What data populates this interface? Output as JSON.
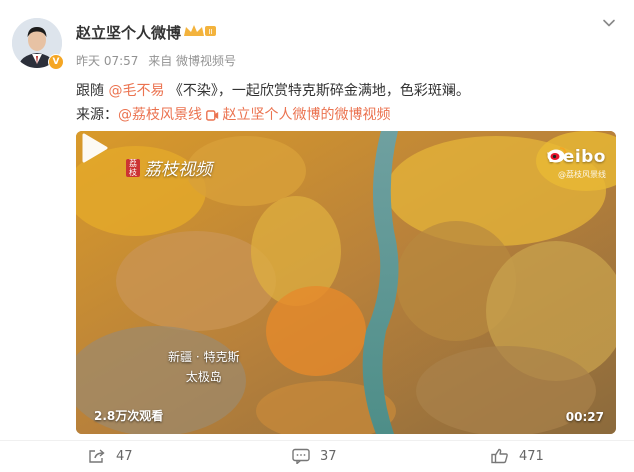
{
  "post": {
    "author": "赵立坚个人微博",
    "time": "昨天 07:57",
    "source": "来自 微博视频号",
    "text_prefix": "跟随 ",
    "mention": "@毛不易",
    "text_rest": " 《不染》，一起欣赏特克斯碎金满地，色彩斑斓。",
    "source_label": "来源：",
    "source_link": "@荔枝风景线",
    "source_video": "赵立坚个人微博的微博视频"
  },
  "video": {
    "badge_box": "荔枝",
    "badge_text": "荔枝视频",
    "watermark": "weibo",
    "watermark_sub": "@荔枝风景线",
    "place_line1": "新疆 · 特克斯",
    "place_line2": "太极岛",
    "views": "2.8万次观看",
    "duration": "00:27"
  },
  "actions": {
    "forward_count": "47",
    "comment_count": "37",
    "like_count": "471"
  },
  "colors": {
    "link": "#eb7350",
    "muted": "#939393",
    "badge": "#f5a623"
  },
  "icons": [
    "avatar",
    "verified-badge-icon",
    "crown-icon",
    "chevron-down-icon",
    "video-link-icon",
    "play-icon",
    "weibo-eye-icon",
    "forward-icon",
    "comment-icon",
    "like-icon"
  ]
}
